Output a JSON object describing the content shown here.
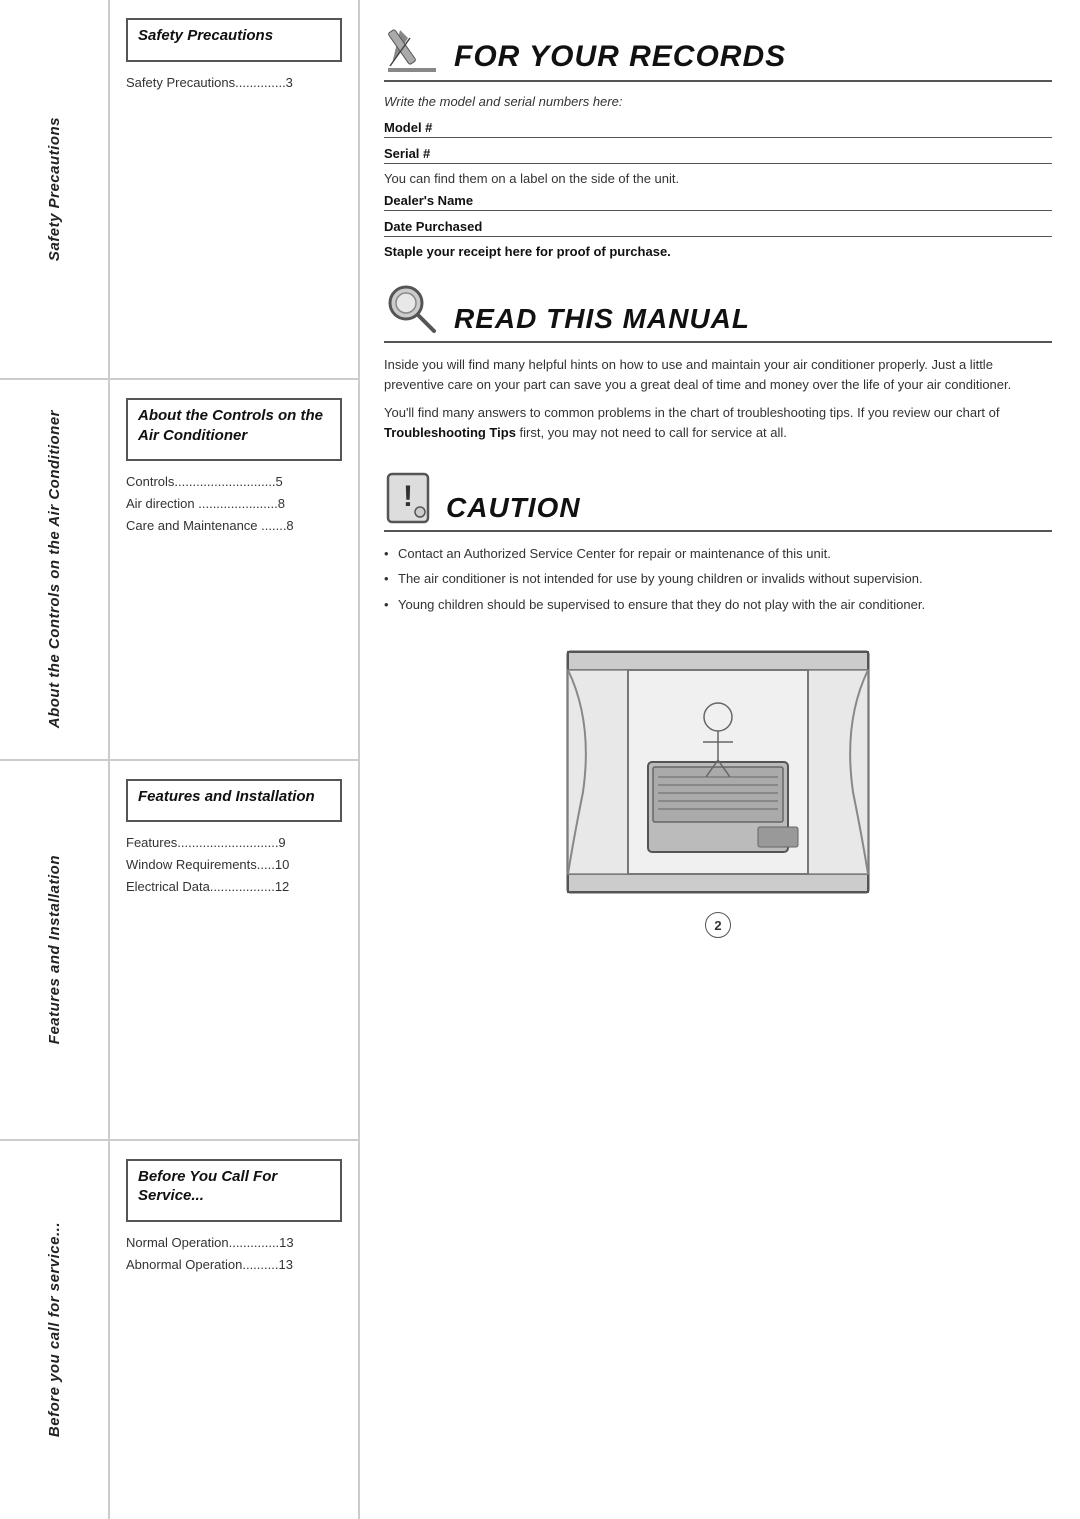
{
  "sidebar": {
    "sections": [
      {
        "label": "Safety Precautions"
      },
      {
        "label": "About the Controls on the Air Conditioner"
      },
      {
        "label": "Features and Installation"
      },
      {
        "label": "Before you call for service..."
      }
    ]
  },
  "toc": {
    "sections": [
      {
        "title": "Safety Precautions",
        "boxed": true,
        "items": [
          "Safety Precautions..............3"
        ]
      },
      {
        "title": "About the Controls on the Air Conditioner",
        "boxed": true,
        "items": [
          "Controls............................5",
          "Air direction ......................8",
          "Care and Maintenance .......8"
        ]
      },
      {
        "title": "Features and Installation",
        "boxed": true,
        "items": [
          "Features............................9",
          "Window Requirements.....10",
          "Electrical Data..................12"
        ]
      },
      {
        "title": "Before You Call For Service...",
        "boxed": true,
        "items": [
          "Normal Operation..............13",
          "Abnormal Operation..........13"
        ]
      }
    ]
  },
  "main": {
    "for_your_records": {
      "title": "FOR YOUR RECORDS",
      "subtitle": "Write the model and serial numbers here:",
      "fields": [
        {
          "label": "Model #",
          "line": true
        },
        {
          "label": "Serial #",
          "line": true
        },
        {
          "text": "You can find them on a label on the side of the unit."
        },
        {
          "label": "Dealer's Name",
          "line": true
        },
        {
          "label": "Date Purchased",
          "line": true
        }
      ],
      "staple_text": "Staple your receipt here for proof of purchase."
    },
    "read_this_manual": {
      "title": "READ THIS MANUAL",
      "paragraphs": [
        "Inside you will find many helpful hints on how to use and maintain your air conditioner properly. Just a little preventive care on your part can save you a great deal of time and money over the life of your air conditioner.",
        "You'll find many answers to common problems in the chart of troubleshooting tips. If you review our chart of Troubleshooting Tips first, you may not need to call for service at all."
      ],
      "bold_phrase": "Troubleshooting Tips"
    },
    "caution": {
      "title": "CAUTION",
      "items": [
        "Contact an Authorized Service Center for repair or maintenance of this unit.",
        "The air conditioner is not intended for use by young children or invalids without supervision.",
        "Young children should be supervised to ensure that they do not play with the air conditioner."
      ]
    },
    "page_number": "2"
  }
}
